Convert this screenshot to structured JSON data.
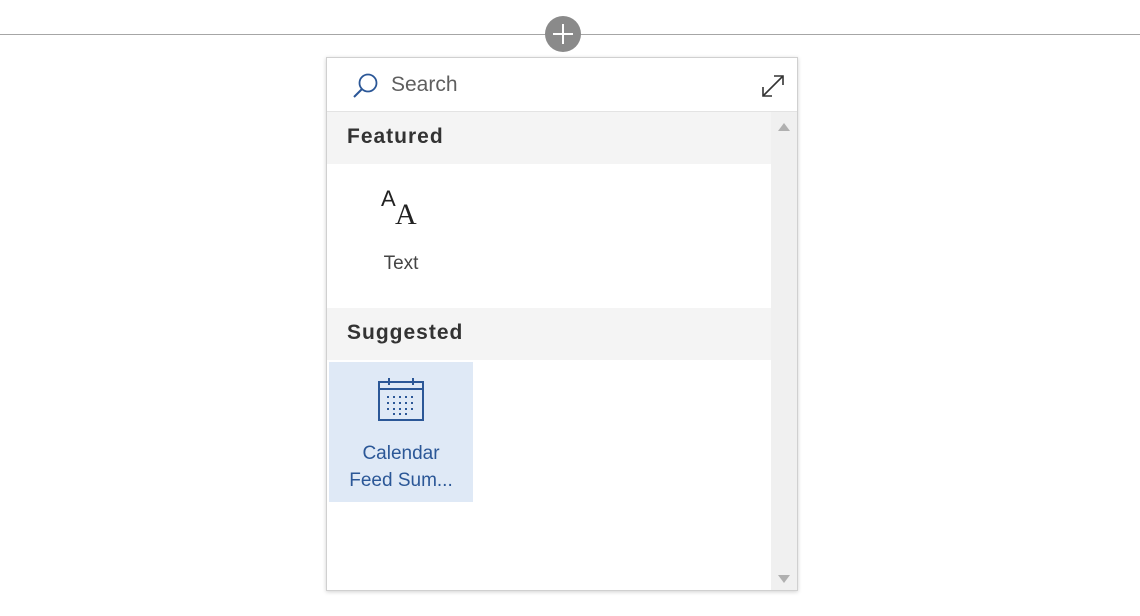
{
  "search": {
    "placeholder": "Search"
  },
  "sections": {
    "featured": {
      "title": "Featured",
      "items": [
        {
          "label": "Text",
          "icon": "text-icon"
        }
      ]
    },
    "suggested": {
      "title": "Suggested",
      "items": [
        {
          "label_line1": "Calendar",
          "label_line2": "Feed Sum...",
          "icon": "calendar-icon"
        }
      ]
    }
  },
  "colors": {
    "accent": "#2b5797",
    "selected_tile_bg": "#dfe9f6",
    "section_bg": "#f4f4f4",
    "add_button": "#8a8a8a"
  }
}
